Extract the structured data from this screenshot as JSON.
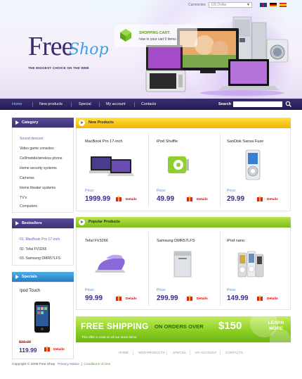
{
  "topbar": {
    "currencies_label": "Currencies:",
    "currency_value": "US Dollar"
  },
  "logo": {
    "free": "Free",
    "shop": "Shop",
    "tagline": "THE BIGGEST CHOICE ON THE WEB"
  },
  "cart": {
    "title": "SHOPPING CART:",
    "count_text": "now in your cart 0 items"
  },
  "nav": {
    "items": [
      "Home",
      "New products",
      "Special",
      "My account",
      "Contacts"
    ],
    "search_label": "Search"
  },
  "sidebar": {
    "category_title": "Category",
    "categories": [
      "Sound devices",
      "Video game consoles",
      "Cell/mobile/wireless phone",
      "Home security systems",
      "Cameras",
      "Home theater systems",
      "TV's",
      "Computers"
    ],
    "bestsellers_title": "Bestsellers",
    "bestsellers": [
      "01. MacBook Pro 17-inch",
      "02. Tefal FV3266",
      "03. Samsung DMR57LFS"
    ],
    "specials_title": "Specials",
    "special": {
      "name": "Ipod Touch",
      "old_price": "$99.99",
      "price": "119.99",
      "detail": "Details"
    }
  },
  "new_products": {
    "title": "New Products",
    "items": [
      {
        "name": "MacBook Pro 17-inch",
        "price_label": "Price:",
        "price": "1999.99",
        "detail": "Details"
      },
      {
        "name": "iPod Shuffle",
        "price_label": "Price:",
        "price": "49.99",
        "detail": "Details"
      },
      {
        "name": "SanDisk Sansa Fuze",
        "price_label": "Price:",
        "price": "29.99",
        "detail": "Details"
      }
    ]
  },
  "popular_products": {
    "title": "Popular Products",
    "items": [
      {
        "name": "Tefal FV3266",
        "price_label": "Price:",
        "price": "99.99",
        "detail": "Details"
      },
      {
        "name": "Samsung DMR57LFS",
        "price_label": "Price:",
        "price": "299.99",
        "detail": "Details"
      },
      {
        "name": "iPod nano",
        "price_label": "Price:",
        "price": "149.99",
        "detail": "Details"
      }
    ]
  },
  "banner": {
    "free_shipping": "FREE SHIPPING",
    "on_orders": "ON ORDERS OVER",
    "amount": "$150",
    "note": "This offer is valid on all our store items.",
    "learn_more": "LEARN\nMORE"
  },
  "footer": {
    "links": [
      "HOME",
      "NEW PRODUCTS",
      "SPECIAL",
      "MY ACCOUNT",
      "CONTACTS"
    ],
    "copyright": "Copyright © 2009 Free Shop",
    "privacy": "Privacy Notice",
    "conditions": "Conditions of Use"
  },
  "colors": {
    "nav": "#2d2460",
    "accent_purple": "#3a2a8e",
    "new_products": "#f5b300",
    "popular_products": "#7cbd1c",
    "specials": "#2a7cc2"
  }
}
